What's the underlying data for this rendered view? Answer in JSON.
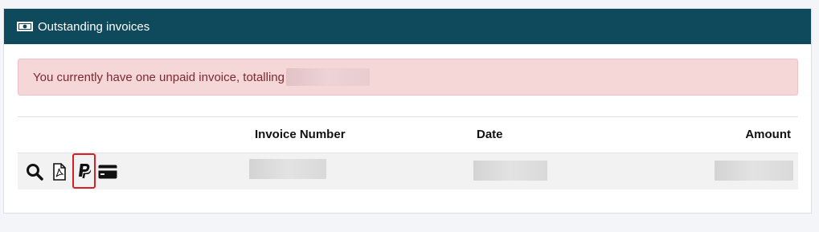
{
  "panel": {
    "title": "Outstanding invoices",
    "title_icon": "money-bill-icon",
    "header_color": "#0e4a5c"
  },
  "alert": {
    "message": "You currently have one unpaid invoice, totalling",
    "total": "",
    "background": "#f5d7d8",
    "text_color": "#7a2a30"
  },
  "table": {
    "columns": {
      "actions": "",
      "invoice_number": "Invoice Number",
      "date": "Date",
      "amount": "Amount"
    },
    "rows": [
      {
        "actions": [
          "view-icon",
          "pdf-icon",
          "paypal-icon",
          "credit-card-icon"
        ],
        "highlighted_action": "paypal-icon",
        "invoice_number": "",
        "date": "",
        "amount": ""
      }
    ]
  }
}
